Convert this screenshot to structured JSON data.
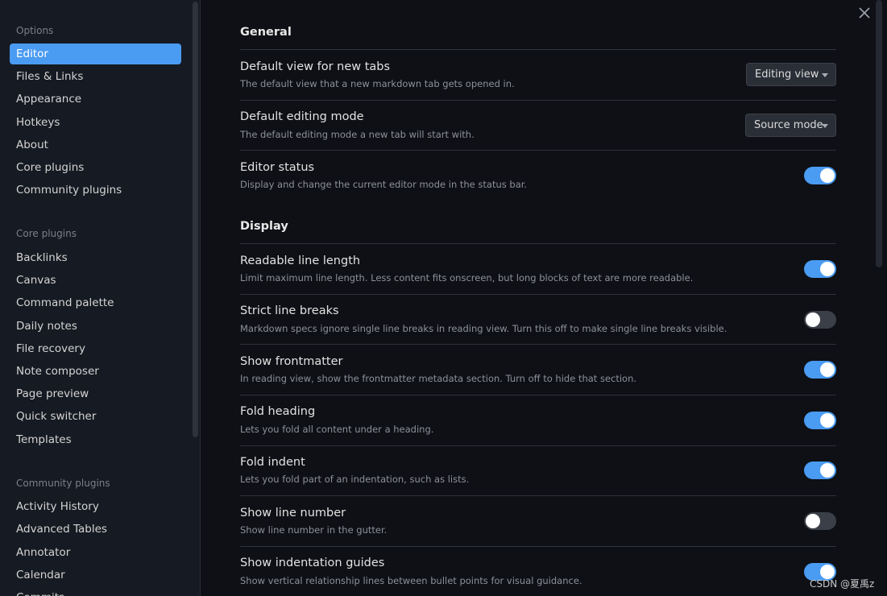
{
  "sidebar": {
    "options_heading": "Options",
    "options": [
      {
        "label": "Editor",
        "active": true
      },
      {
        "label": "Files & Links"
      },
      {
        "label": "Appearance"
      },
      {
        "label": "Hotkeys"
      },
      {
        "label": "About"
      },
      {
        "label": "Core plugins"
      },
      {
        "label": "Community plugins"
      }
    ],
    "core_heading": "Core plugins",
    "core_plugins": [
      {
        "label": "Backlinks"
      },
      {
        "label": "Canvas"
      },
      {
        "label": "Command palette"
      },
      {
        "label": "Daily notes"
      },
      {
        "label": "File recovery"
      },
      {
        "label": "Note composer"
      },
      {
        "label": "Page preview"
      },
      {
        "label": "Quick switcher"
      },
      {
        "label": "Templates"
      }
    ],
    "community_heading": "Community plugins",
    "community_plugins": [
      {
        "label": "Activity History"
      },
      {
        "label": "Advanced Tables"
      },
      {
        "label": "Annotator"
      },
      {
        "label": "Calendar"
      },
      {
        "label": "Commits"
      }
    ]
  },
  "close_icon": "close-icon",
  "sections": {
    "general": "General",
    "display": "Display"
  },
  "settings": {
    "default_view": {
      "name": "Default view for new tabs",
      "desc": "The default view that a new markdown tab gets opened in.",
      "value": "Editing view"
    },
    "default_editing_mode": {
      "name": "Default editing mode",
      "desc": "The default editing mode a new tab will start with.",
      "value": "Source mode"
    },
    "editor_status": {
      "name": "Editor status",
      "desc": "Display and change the current editor mode in the status bar.",
      "enabled": true
    },
    "readable_line_length": {
      "name": "Readable line length",
      "desc": "Limit maximum line length. Less content fits onscreen, but long blocks of text are more readable.",
      "enabled": true
    },
    "strict_line_breaks": {
      "name": "Strict line breaks",
      "desc": "Markdown specs ignore single line breaks in reading view. Turn this off to make single line breaks visible.",
      "enabled": false
    },
    "show_frontmatter": {
      "name": "Show frontmatter",
      "desc": "In reading view, show the frontmatter metadata section. Turn off to hide that section.",
      "enabled": true
    },
    "fold_heading": {
      "name": "Fold heading",
      "desc": "Lets you fold all content under a heading.",
      "enabled": true
    },
    "fold_indent": {
      "name": "Fold indent",
      "desc": "Lets you fold part of an indentation, such as lists.",
      "enabled": true
    },
    "show_line_number": {
      "name": "Show line number",
      "desc": "Show line number in the gutter.",
      "enabled": false
    },
    "show_indentation_guides": {
      "name": "Show indentation guides",
      "desc": "Show vertical relationship lines between bullet points for visual guidance.",
      "enabled": true
    }
  },
  "watermark": "CSDN @夏禹z",
  "colors": {
    "accent": "#4a9bf2",
    "sidebar_bg": "#161a22",
    "main_bg": "#0e1015"
  }
}
